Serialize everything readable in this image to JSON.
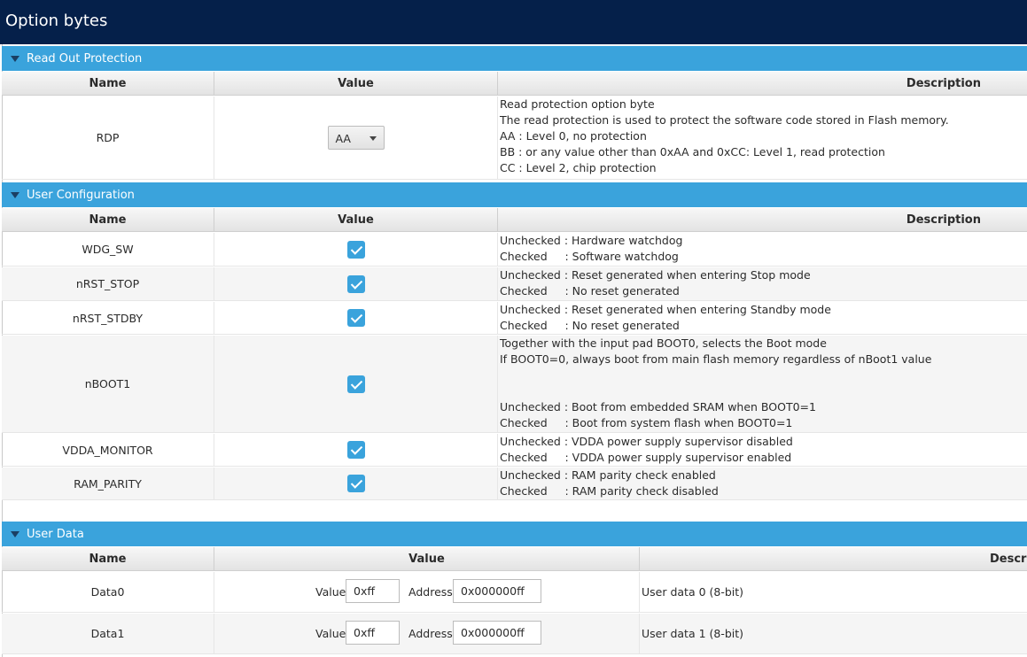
{
  "window": {
    "title": "Option bytes"
  },
  "sections": {
    "rop": {
      "title": "Read Out Protection"
    },
    "user_config": {
      "title": "User Configuration"
    },
    "user_data": {
      "title": "User Data"
    }
  },
  "columns": {
    "name": "Name",
    "value": "Value",
    "description": "Description",
    "description_truncated": "Descrip"
  },
  "rdp": {
    "name": "RDP",
    "value": "AA",
    "description": [
      "Read protection option byte",
      "The read protection is used to protect the software code stored in Flash memory.",
      "AA : Level 0, no protection",
      "BB : or any value other than 0xAA and 0xCC: Level 1, read protection",
      "CC : Level 2, chip protection"
    ]
  },
  "user_config_rows": [
    {
      "name": "WDG_SW",
      "checked": true,
      "description": [
        "Unchecked : Hardware watchdog",
        "Checked     : Software watchdog"
      ]
    },
    {
      "name": "nRST_STOP",
      "checked": true,
      "description": [
        "Unchecked : Reset generated when entering Stop mode",
        "Checked     : No reset generated"
      ]
    },
    {
      "name": "nRST_STDBY",
      "checked": true,
      "description": [
        "Unchecked : Reset generated when entering Standby mode",
        "Checked     : No reset generated"
      ]
    },
    {
      "name": "nBOOT1",
      "checked": true,
      "description": [
        "Together with the input pad BOOT0, selects the Boot mode",
        "If BOOT0=0, always boot from main flash memory regardless of nBoot1 value",
        "",
        "",
        "Unchecked : Boot from embedded SRAM when BOOT0=1",
        "Checked     : Boot from system flash when BOOT0=1"
      ]
    },
    {
      "name": "VDDA_MONITOR",
      "checked": true,
      "description": [
        "Unchecked : VDDA power supply supervisor disabled",
        "Checked     : VDDA power supply supervisor enabled"
      ]
    },
    {
      "name": "RAM_PARITY",
      "checked": true,
      "description": [
        "Unchecked : RAM parity check enabled",
        "Checked     : RAM parity check disabled"
      ]
    }
  ],
  "user_data_rows": [
    {
      "name": "Data0",
      "value_label": "Value",
      "value": "0xff",
      "address_label": "Address",
      "address": "0x000000ff",
      "description": "User data 0 (8-bit)"
    },
    {
      "name": "Data1",
      "value_label": "Value",
      "value": "0xff",
      "address_label": "Address",
      "address": "0x000000ff",
      "description": "User data 1 (8-bit)"
    }
  ],
  "colors": {
    "titlebar": "#05204a",
    "section_header": "#3aa3dc",
    "checkbox": "#3aa3dc"
  },
  "icons": {
    "section_toggle": "triangle-down-icon",
    "checkbox": "checkmark-icon",
    "dropdown": "chevron-down-icon"
  }
}
